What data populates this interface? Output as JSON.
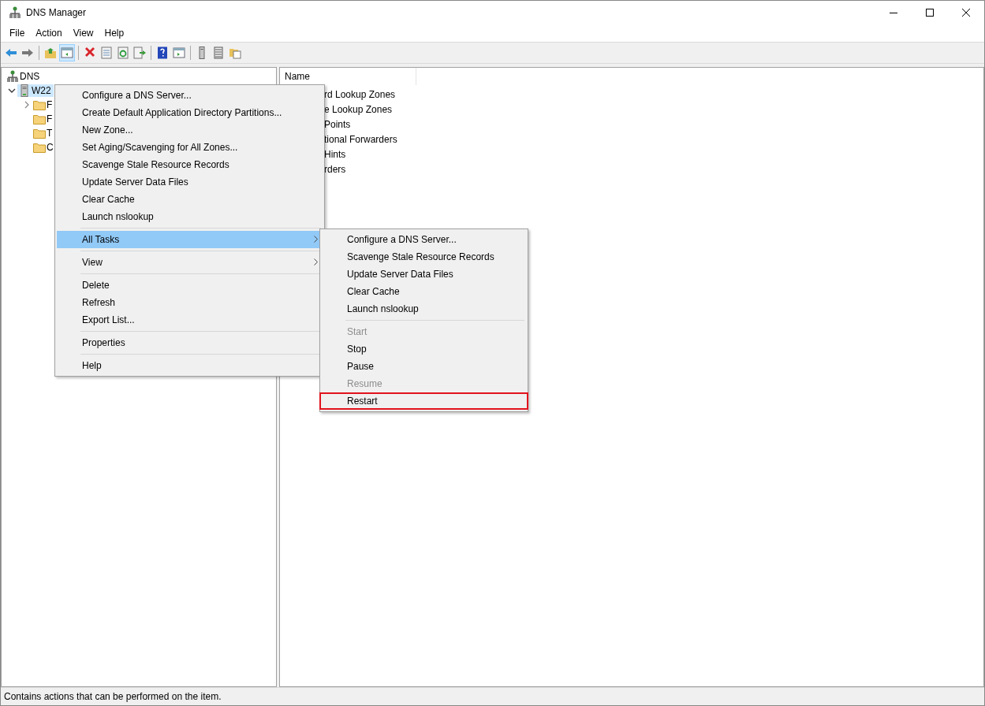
{
  "window": {
    "title": "DNS Manager"
  },
  "menu_bar": [
    "File",
    "Action",
    "View",
    "Help"
  ],
  "toolbar": [
    {
      "kind": "back",
      "pressed": false
    },
    {
      "kind": "forward",
      "pressed": false
    },
    {
      "kind": "sep"
    },
    {
      "kind": "up",
      "pressed": false
    },
    {
      "kind": "tree",
      "pressed": true
    },
    {
      "kind": "sep"
    },
    {
      "kind": "delete",
      "pressed": false
    },
    {
      "kind": "properties",
      "pressed": false
    },
    {
      "kind": "refresh",
      "pressed": false
    },
    {
      "kind": "export",
      "pressed": false
    },
    {
      "kind": "sep"
    },
    {
      "kind": "help",
      "pressed": false
    },
    {
      "kind": "action",
      "pressed": false
    },
    {
      "kind": "sep"
    },
    {
      "kind": "server",
      "pressed": false
    },
    {
      "kind": "list",
      "pressed": false
    },
    {
      "kind": "folders",
      "pressed": false
    }
  ],
  "tree": [
    {
      "label": "DNS",
      "kind": "root",
      "selected": false,
      "children": [
        {
          "label": "W22",
          "kind": "server",
          "selected": true,
          "expanded": true,
          "children": [
            {
              "label": "F",
              "kind": "folder",
              "selected": false,
              "expanded": false
            },
            {
              "label": "F",
              "kind": "folder",
              "selected": false
            },
            {
              "label": "T",
              "kind": "folder",
              "selected": false
            },
            {
              "label": "C",
              "kind": "folder",
              "selected": false
            }
          ]
        }
      ]
    }
  ],
  "list": {
    "columns": [
      "Name"
    ],
    "rows": [
      "rd Lookup Zones",
      "e Lookup Zones",
      "Points",
      "tional Forwarders",
      "Hints",
      "rders"
    ]
  },
  "context_menu": {
    "groups": [
      [
        {
          "label": "Configure a DNS Server...",
          "selected": false,
          "disabled": false
        },
        {
          "label": "Create Default Application Directory Partitions...",
          "selected": false,
          "disabled": false
        },
        {
          "label": "New Zone...",
          "selected": false,
          "disabled": false
        },
        {
          "label": "Set Aging/Scavenging for All Zones...",
          "selected": false,
          "disabled": false
        },
        {
          "label": "Scavenge Stale Resource Records",
          "selected": false,
          "disabled": false
        },
        {
          "label": "Update Server Data Files",
          "selected": false,
          "disabled": false
        },
        {
          "label": "Clear Cache",
          "selected": false,
          "disabled": false
        },
        {
          "label": "Launch nslookup",
          "selected": false,
          "disabled": false
        }
      ],
      [
        {
          "label": "All Tasks",
          "selected": true,
          "disabled": false,
          "submenu": true
        }
      ],
      [
        {
          "label": "View",
          "selected": false,
          "disabled": false,
          "submenu": true
        }
      ],
      [
        {
          "label": "Delete",
          "selected": false,
          "disabled": false
        },
        {
          "label": "Refresh",
          "selected": false,
          "disabled": false
        },
        {
          "label": "Export List...",
          "selected": false,
          "disabled": false
        }
      ],
      [
        {
          "label": "Properties",
          "selected": false,
          "disabled": false
        }
      ],
      [
        {
          "label": "Help",
          "selected": false,
          "disabled": false
        }
      ]
    ]
  },
  "submenu": {
    "groups": [
      [
        {
          "label": "Configure a DNS Server...",
          "selected": false,
          "disabled": false,
          "highlighted": false
        },
        {
          "label": "Scavenge Stale Resource Records",
          "selected": false,
          "disabled": false,
          "highlighted": false
        },
        {
          "label": "Update Server Data Files",
          "selected": false,
          "disabled": false,
          "highlighted": false
        },
        {
          "label": "Clear Cache",
          "selected": false,
          "disabled": false,
          "highlighted": false
        },
        {
          "label": "Launch nslookup",
          "selected": false,
          "disabled": false,
          "highlighted": false
        }
      ],
      [
        {
          "label": "Start",
          "selected": false,
          "disabled": true,
          "highlighted": false
        },
        {
          "label": "Stop",
          "selected": false,
          "disabled": false,
          "highlighted": false
        },
        {
          "label": "Pause",
          "selected": false,
          "disabled": false,
          "highlighted": false
        },
        {
          "label": "Resume",
          "selected": false,
          "disabled": true,
          "highlighted": false
        },
        {
          "label": "Restart",
          "selected": false,
          "disabled": false,
          "highlighted": true
        }
      ]
    ]
  },
  "status_bar": "Contains actions that can be performed on the item."
}
